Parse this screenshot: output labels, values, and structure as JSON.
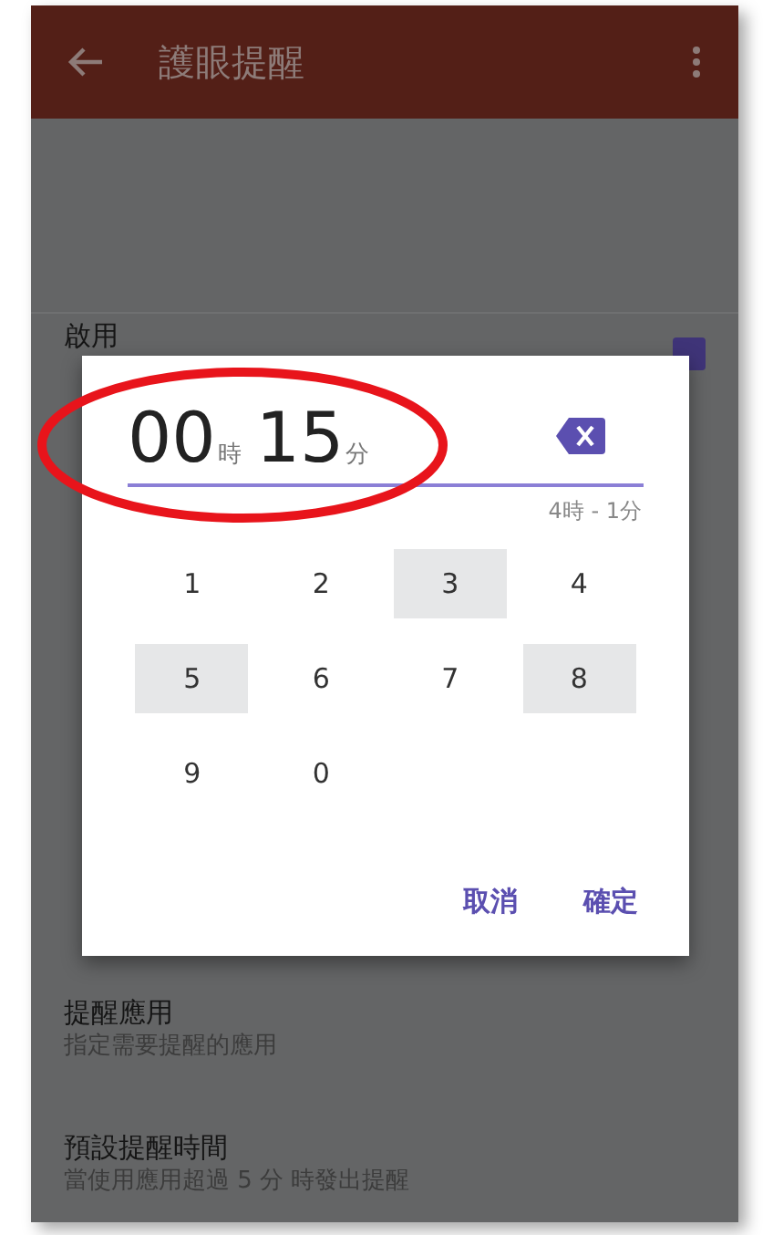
{
  "app_bar": {
    "title": "護眼提醒"
  },
  "settings": [
    {
      "title": "啟用",
      "checked": true
    },
    {
      "title": "提醒應用",
      "subtitle": "指定需要提醒的應用"
    },
    {
      "title": "預設提醒時間",
      "subtitle": "當使用應用超過 5 分 時發出提醒"
    }
  ],
  "dialog": {
    "hours": "00",
    "hours_unit": "時",
    "minutes": "15",
    "minutes_unit": "分",
    "range": "4時 - 1分",
    "keys": [
      {
        "label": "1",
        "highlighted": false
      },
      {
        "label": "2",
        "highlighted": false
      },
      {
        "label": "3",
        "highlighted": true
      },
      {
        "label": "4",
        "highlighted": false
      },
      {
        "label": "5",
        "highlighted": true
      },
      {
        "label": "6",
        "highlighted": false
      },
      {
        "label": "7",
        "highlighted": false
      },
      {
        "label": "8",
        "highlighted": true
      },
      {
        "label": "9",
        "highlighted": false
      },
      {
        "label": "0",
        "highlighted": false
      }
    ],
    "buttons": [
      "取消",
      "確定"
    ]
  }
}
